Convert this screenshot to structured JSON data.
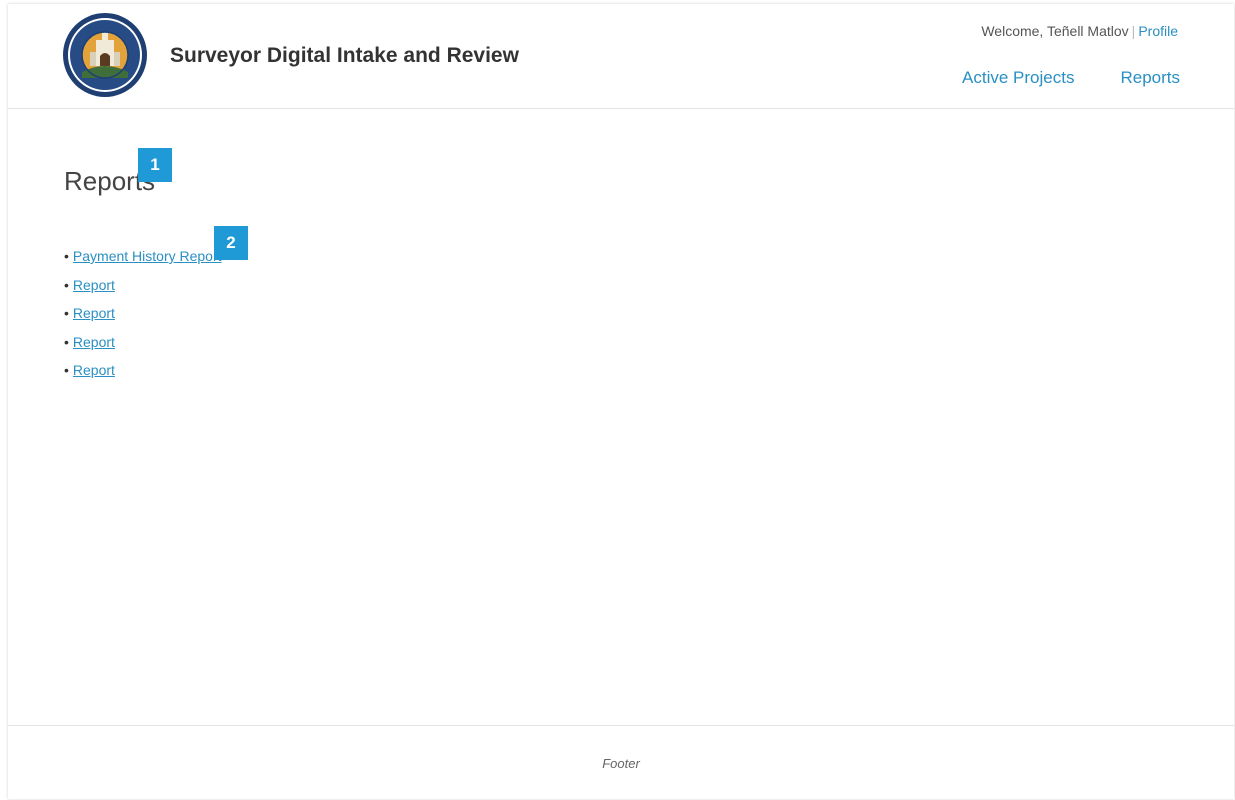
{
  "header": {
    "seal_label": "COUNTY OF SANTA BARBARA CALIFORNIA",
    "app_title": "Surveyor Digital Intake and Review",
    "welcome_text": "Welcome, Teñell Matlov",
    "separator": "|",
    "profile_label": "Profile",
    "nav": {
      "active_projects": "Active Projects",
      "reports": "Reports"
    }
  },
  "main": {
    "heading": "Reports",
    "bullet": "•",
    "reports": [
      {
        "label": "Payment History Report"
      },
      {
        "label": "Report"
      },
      {
        "label": "Report"
      },
      {
        "label": "Report"
      },
      {
        "label": "Report"
      }
    ]
  },
  "markers": {
    "m1": "1",
    "m2": "2"
  },
  "footer": {
    "text": "Footer"
  },
  "colors": {
    "link": "#2a8fc3",
    "marker": "#1f9ad6"
  },
  "icons": {
    "seal": "county-seal-icon"
  }
}
